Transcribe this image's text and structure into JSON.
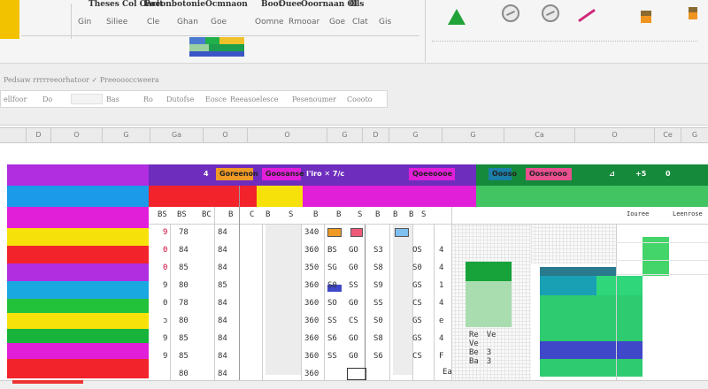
{
  "ribbon": {
    "title_1": "Theses Col Oacit",
    "title_2": "Poeonbotonie",
    "title_3": "Ocmnaon",
    "title_4": "Boot",
    "title_5": "Ouee",
    "title_6": "Ooornaan Ol",
    "title_7": "Ols",
    "buttons_row": [
      "Gin",
      "Siliee",
      "Cle",
      "Ghan",
      "Goe",
      "Oomne",
      "Rmooar",
      "Goe",
      "Clat",
      "Gis"
    ]
  },
  "formula": {
    "line_1": "Pedsaw rrrrreeorhatoor ✓ Preeoooccweera",
    "line_2_label": "ellfoor",
    "line_2_items": [
      "Do",
      "Bas",
      "Ro",
      "Dutofse",
      "Eosce",
      "Reeasoelesce",
      "Pesenoumer",
      "Coooto"
    ]
  },
  "columns": {
    "headers": [
      "",
      "D",
      "O",
      "G",
      "Ga",
      "O",
      "O",
      "G",
      "D",
      "G",
      "G",
      "Ca",
      "O",
      "Ce",
      "G"
    ]
  },
  "grid": {
    "header_labels": {
      "h1": "4",
      "h2": "Goreenon",
      "h3": "Goosanse",
      "h4": "I'iro ✕ 7/c",
      "h5": "Qoeeoooe",
      "h6": "Oooso",
      "h7": "Ooserooo",
      "h8": "⊿",
      "h9": "+5",
      "h10": "0"
    },
    "sub_headers": [
      "BS",
      "BS",
      "BC",
      "B",
      "C",
      "B",
      "S",
      "B",
      "B",
      "S",
      "B",
      "B",
      "B",
      "S",
      "Iouree",
      "Leenrose"
    ],
    "col_a": [
      "9",
      "0",
      "0",
      "9",
      "0",
      "ɔ",
      "9",
      "9",
      "9"
    ],
    "col_b": [
      "78",
      "84",
      "85",
      "80",
      "78",
      "80",
      "85",
      "85",
      "80"
    ],
    "col_c": [
      "84",
      "84",
      "84",
      "85",
      "84",
      "84",
      "84",
      "84",
      "84"
    ],
    "col_d": [
      "340",
      "360",
      "350",
      "360",
      "360",
      "360",
      "360",
      "360",
      "360"
    ],
    "col_e": [
      "BS",
      "SG",
      "S0",
      "SO",
      "SS",
      "S6",
      "SS",
      "SS",
      "SS"
    ],
    "col_f": [
      "GO",
      "G0",
      "SS",
      "G0",
      "CS",
      "GO",
      "G0",
      "GO",
      "GO"
    ],
    "col_g": [
      "S3",
      "S8",
      "S9",
      "SS",
      "S0",
      "S8",
      "S6",
      "S6",
      "SS"
    ],
    "col_h": [
      "OS",
      "S0",
      "GS",
      "CS",
      "GS",
      "GS",
      "CS",
      "GS",
      "GS"
    ],
    "col_i": [
      "4",
      "4",
      "1",
      "4",
      "e",
      "4",
      "F",
      "ꟻ",
      "4"
    ],
    "col_j": [
      "Re",
      "Ve",
      "Ve",
      "Be",
      "3",
      "Ba",
      "3"
    ],
    "bottom": "Ea"
  },
  "colors": {
    "purple": "#b02de0",
    "magenta": "#e11fd8",
    "red": "#f2232b",
    "yellow": "#f6e20a",
    "green": "#17b33a",
    "mid_green": "#43c463",
    "blue_bar": "#1a9ae8",
    "teal": "#1b7fa8",
    "navy": "#1e3d8c",
    "indigo": "#3f48c8",
    "orange_bar": "#f09a26"
  }
}
